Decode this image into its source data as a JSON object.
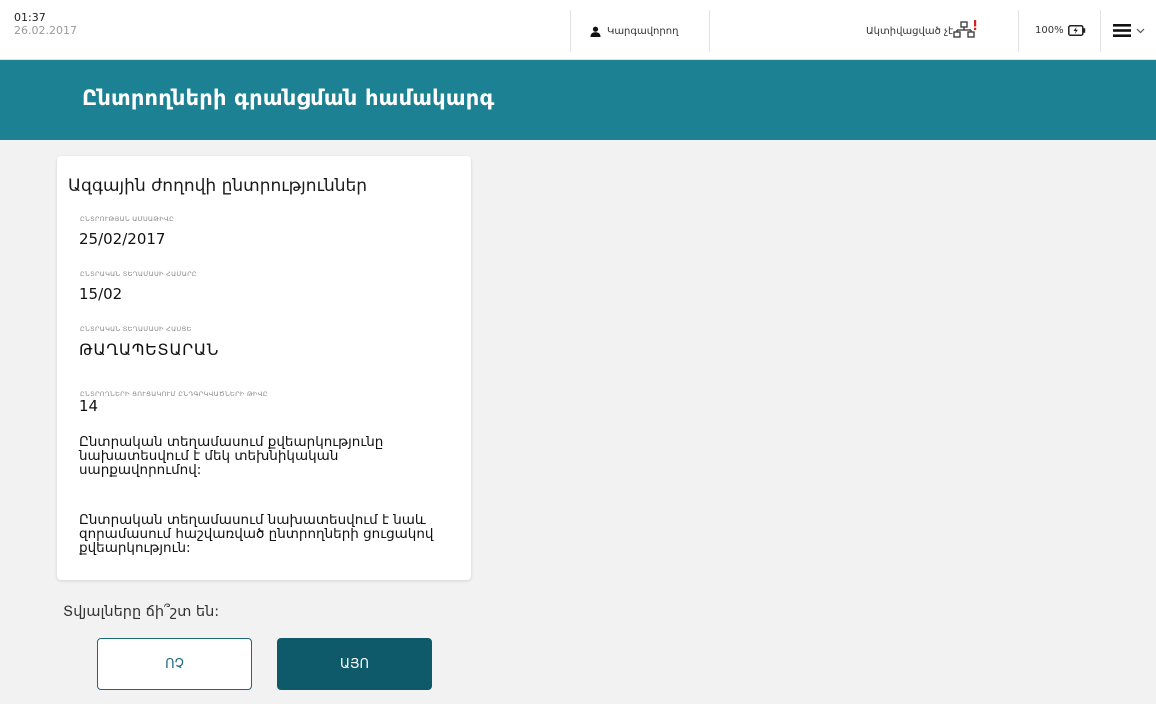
{
  "status_bar": {
    "time": "01:37",
    "date": "26.02.2017",
    "operator_label": "Կարգավորող",
    "connection_status": "Ակտիվացված չէ",
    "battery_percent": "100%",
    "icons": [
      "person-icon",
      "network-icon",
      "battery-icon",
      "menu-icon",
      "chevron-down-icon"
    ],
    "alert_color": "#d8201c"
  },
  "header": {
    "title": "Ընտրողների գրանցման համակարգ",
    "background_color": "#1b8193"
  },
  "election_card": {
    "title": "Ազգային ժողովի ընտրություններ",
    "fields": [
      {
        "label": "ԸՆՏՐՈՒԹՅԱՆ ԱՄՍԱԹԻՎԸ",
        "value": "25/02/2017"
      },
      {
        "label": "ԸՆՏՐԱԿԱՆ ՏԵՂԱՄԱՍԻ ՀԱՄԱՐԸ",
        "value": "15/02"
      },
      {
        "label": "ԸՆՏՐԱԿԱՆ ՏԵՂԱՄԱՍԻ ՀԱՍՑԵ",
        "value": "ԹԱՂԱՊԵՏԱՐԱՆ"
      },
      {
        "label": "ԸՆՏՐՈՂՆԵՐԻ ՑՈՒՑԱԿՈՒՄ ԸՆԴԳՐԿՎԱԾՆԵՐԻ ԹԻՎԸ",
        "value": "14"
      }
    ],
    "notes": [
      "Ընտրական տեղամասում քվեարկությունը նախատեսվում է մեկ տեխնիկական սարքավորումով:",
      "Ընտրական տեղամասում նախատեսվում է նաև զորամասում հաշվառված ընտրողների ցուցակով քվեարկություն:"
    ]
  },
  "confirmation": {
    "question": "Տվյալները ճի՞շտ են:",
    "no_label": "ՈՉ",
    "yes_label": "ԱՅՈ",
    "accent_color": "#0e5a6b"
  }
}
